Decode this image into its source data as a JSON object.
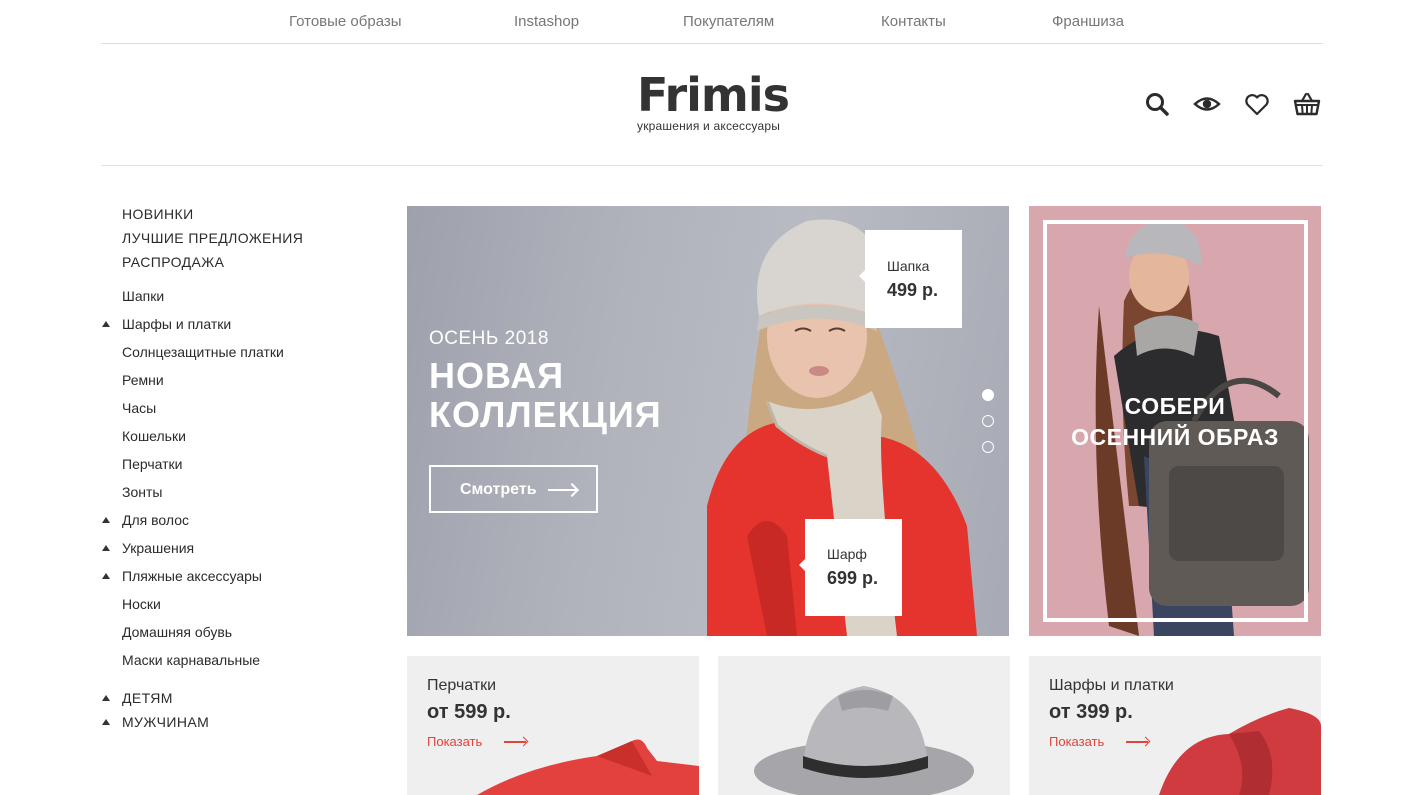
{
  "topnav": [
    "Готовые образы",
    "Instashop",
    "Покупателям",
    "Контакты",
    "Франшиза"
  ],
  "logo": {
    "name": "Frimis",
    "tagline": "украшения и аксессуары"
  },
  "header_icons": [
    "search-icon",
    "eye-icon",
    "heart-icon",
    "basket-icon"
  ],
  "sidebar": {
    "top": [
      "НОВИНКИ",
      "ЛУЧШИЕ ПРЕДЛОЖЕНИЯ",
      "РАСПРОДАЖА"
    ],
    "categories": [
      "Шапки",
      "Шарфы и платки",
      "Солнцезащитные платки",
      "Ремни",
      "Часы",
      "Кошельки",
      "Перчатки",
      "Зонты",
      "Для волос",
      "Украшения",
      "Пляжные аксессуары",
      "Носки",
      "Домашняя обувь",
      "Маски карнавальные"
    ],
    "bottom": [
      "ДЕТЯМ",
      "МУЖЧИНАМ"
    ]
  },
  "hero": {
    "subtitle": "ОСЕНЬ 2018",
    "title_line1": "НОВАЯ",
    "title_line2": "КОЛЛЕКЦИЯ",
    "button": "Смотреть",
    "tag1": {
      "name": "Шапка",
      "price": "499 р."
    },
    "tag2": {
      "name": "Шарф",
      "price": "699 р."
    },
    "slides": 3,
    "active_slide": 1
  },
  "promo": {
    "line1": "СОБЕРИ",
    "line2": "ОСЕННИЙ ОБРАЗ"
  },
  "cards": [
    {
      "category": "Перчатки",
      "price": "от 599 р.",
      "link": "Показать"
    },
    {
      "category": "",
      "price": "",
      "link": ""
    },
    {
      "category": "Шарфы и платки",
      "price": "от 399 р.",
      "link": "Показать"
    }
  ],
  "colors": {
    "accent": "#e0433c",
    "promo_bg": "#d8a6ad",
    "hero_bg": "#b1b3bc",
    "text": "#2b2b2b"
  }
}
